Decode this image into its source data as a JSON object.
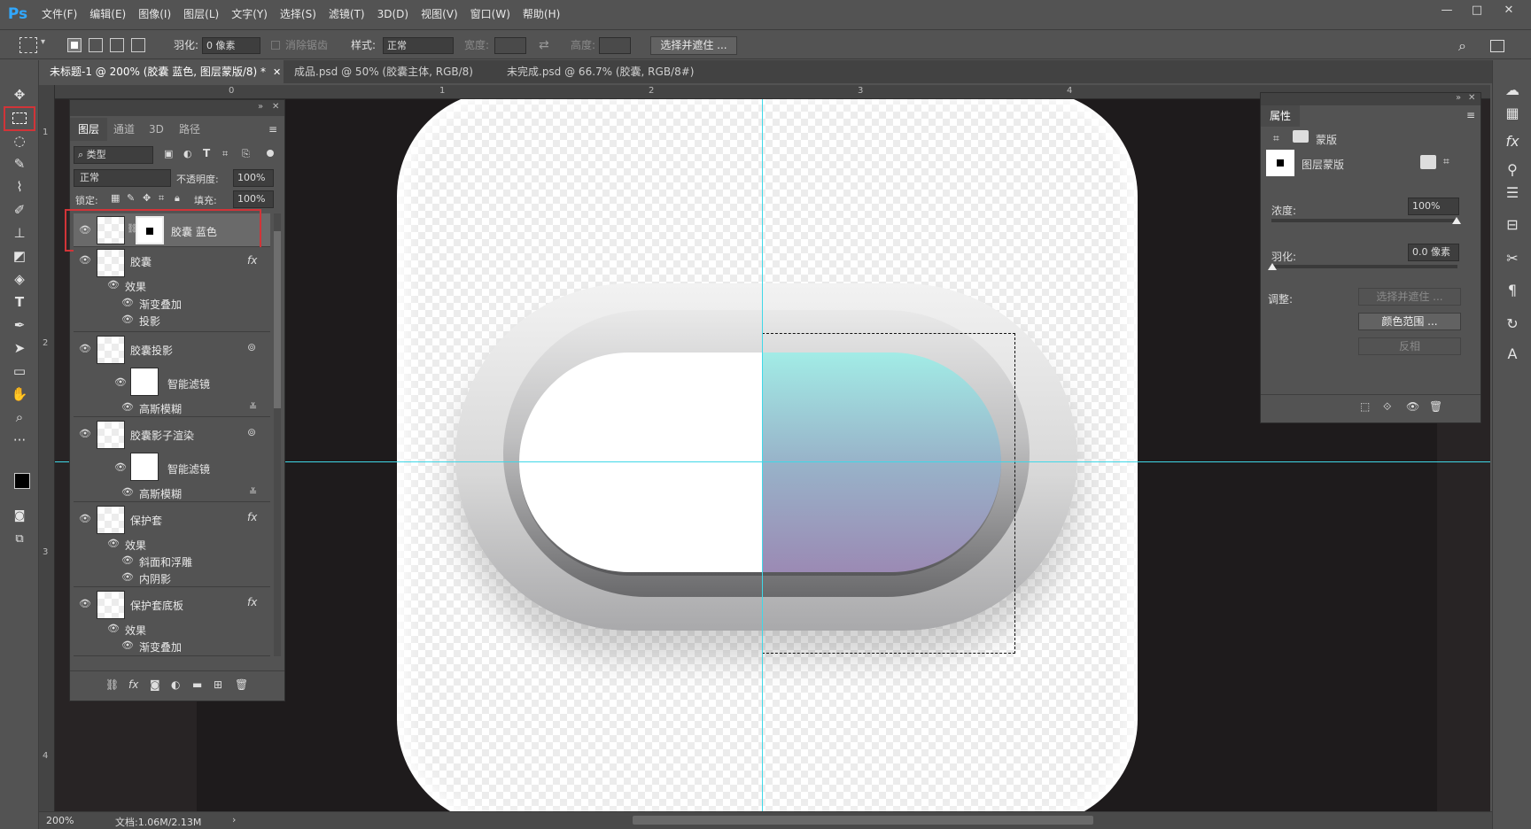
{
  "app": {
    "logo": "Ps"
  },
  "menu": [
    "文件(F)",
    "编辑(E)",
    "图像(I)",
    "图层(L)",
    "文字(Y)",
    "选择(S)",
    "滤镜(T)",
    "3D(D)",
    "视图(V)",
    "窗口(W)",
    "帮助(H)"
  ],
  "window": {
    "min": "—",
    "max": "□",
    "close": "✕"
  },
  "options": {
    "feather_label": "羽化:",
    "feather_value": "0 像素",
    "antialias_label": "消除锯齿",
    "style_label": "样式:",
    "style_value": "正常",
    "width_label": "宽度:",
    "height_label": "高度:",
    "select_mask_button": "选择并遮住 ..."
  },
  "tabs": [
    {
      "label": "未标题-1 @ 200% (胶囊 蓝色, 图层蒙版/8) *",
      "close": "✕"
    },
    {
      "label": "成品.psd @ 50% (胶囊主体, RGB/8) *",
      "close": "✕"
    },
    {
      "label": "未完成.psd @ 66.7% (胶囊, RGB/8#) *",
      "close": "✕"
    }
  ],
  "ruler": {
    "h": [
      "0",
      "1",
      "2",
      "3",
      "4"
    ],
    "v": [
      "1",
      "2",
      "3",
      "4"
    ]
  },
  "layers_panel": {
    "tabs": [
      "图层",
      "通道",
      "3D",
      "路径"
    ],
    "filter_label": "类型",
    "blend_mode": "正常",
    "opacity_label": "不透明度:",
    "opacity_value": "100%",
    "lock_label": "锁定:",
    "fill_label": "填充:",
    "fill_value": "100%",
    "layers": [
      {
        "name": "胶囊 蓝色"
      },
      {
        "name": "胶囊",
        "fx": "fx",
        "effects_label": "效果",
        "effects": [
          "渐变叠加",
          "投影"
        ]
      },
      {
        "name": "胶囊投影",
        "smart_filters": "智能滤镜",
        "filter": "高斯模糊"
      },
      {
        "name": "胶囊影子渲染",
        "smart_filters": "智能滤镜",
        "filter": "高斯模糊"
      },
      {
        "name": "保护套",
        "fx": "fx",
        "effects_label": "效果",
        "effects": [
          "斜面和浮雕",
          "内阴影"
        ]
      },
      {
        "name": "保护套底板",
        "fx": "fx",
        "effects_label": "效果",
        "effects": [
          "渐变叠加"
        ]
      }
    ]
  },
  "properties_panel": {
    "title": "属性",
    "mask_label": "蒙版",
    "layer_mask_label": "图层蒙版",
    "density_label": "浓度:",
    "density_value": "100%",
    "feather_label": "羽化:",
    "feather_value": "0.0 像素",
    "adjust_label": "调整:",
    "select_mask_button": "选择并遮住 ...",
    "color_range_button": "颜色范围 ...",
    "invert_button": "反相"
  },
  "status": {
    "zoom": "200%",
    "doc": "文档:1.06M/2.13M"
  },
  "colors": {
    "accent": "#31a8ff",
    "canvas_bg": "#282425",
    "selection_border": "#d13438",
    "guide": "#3fd8e8"
  }
}
